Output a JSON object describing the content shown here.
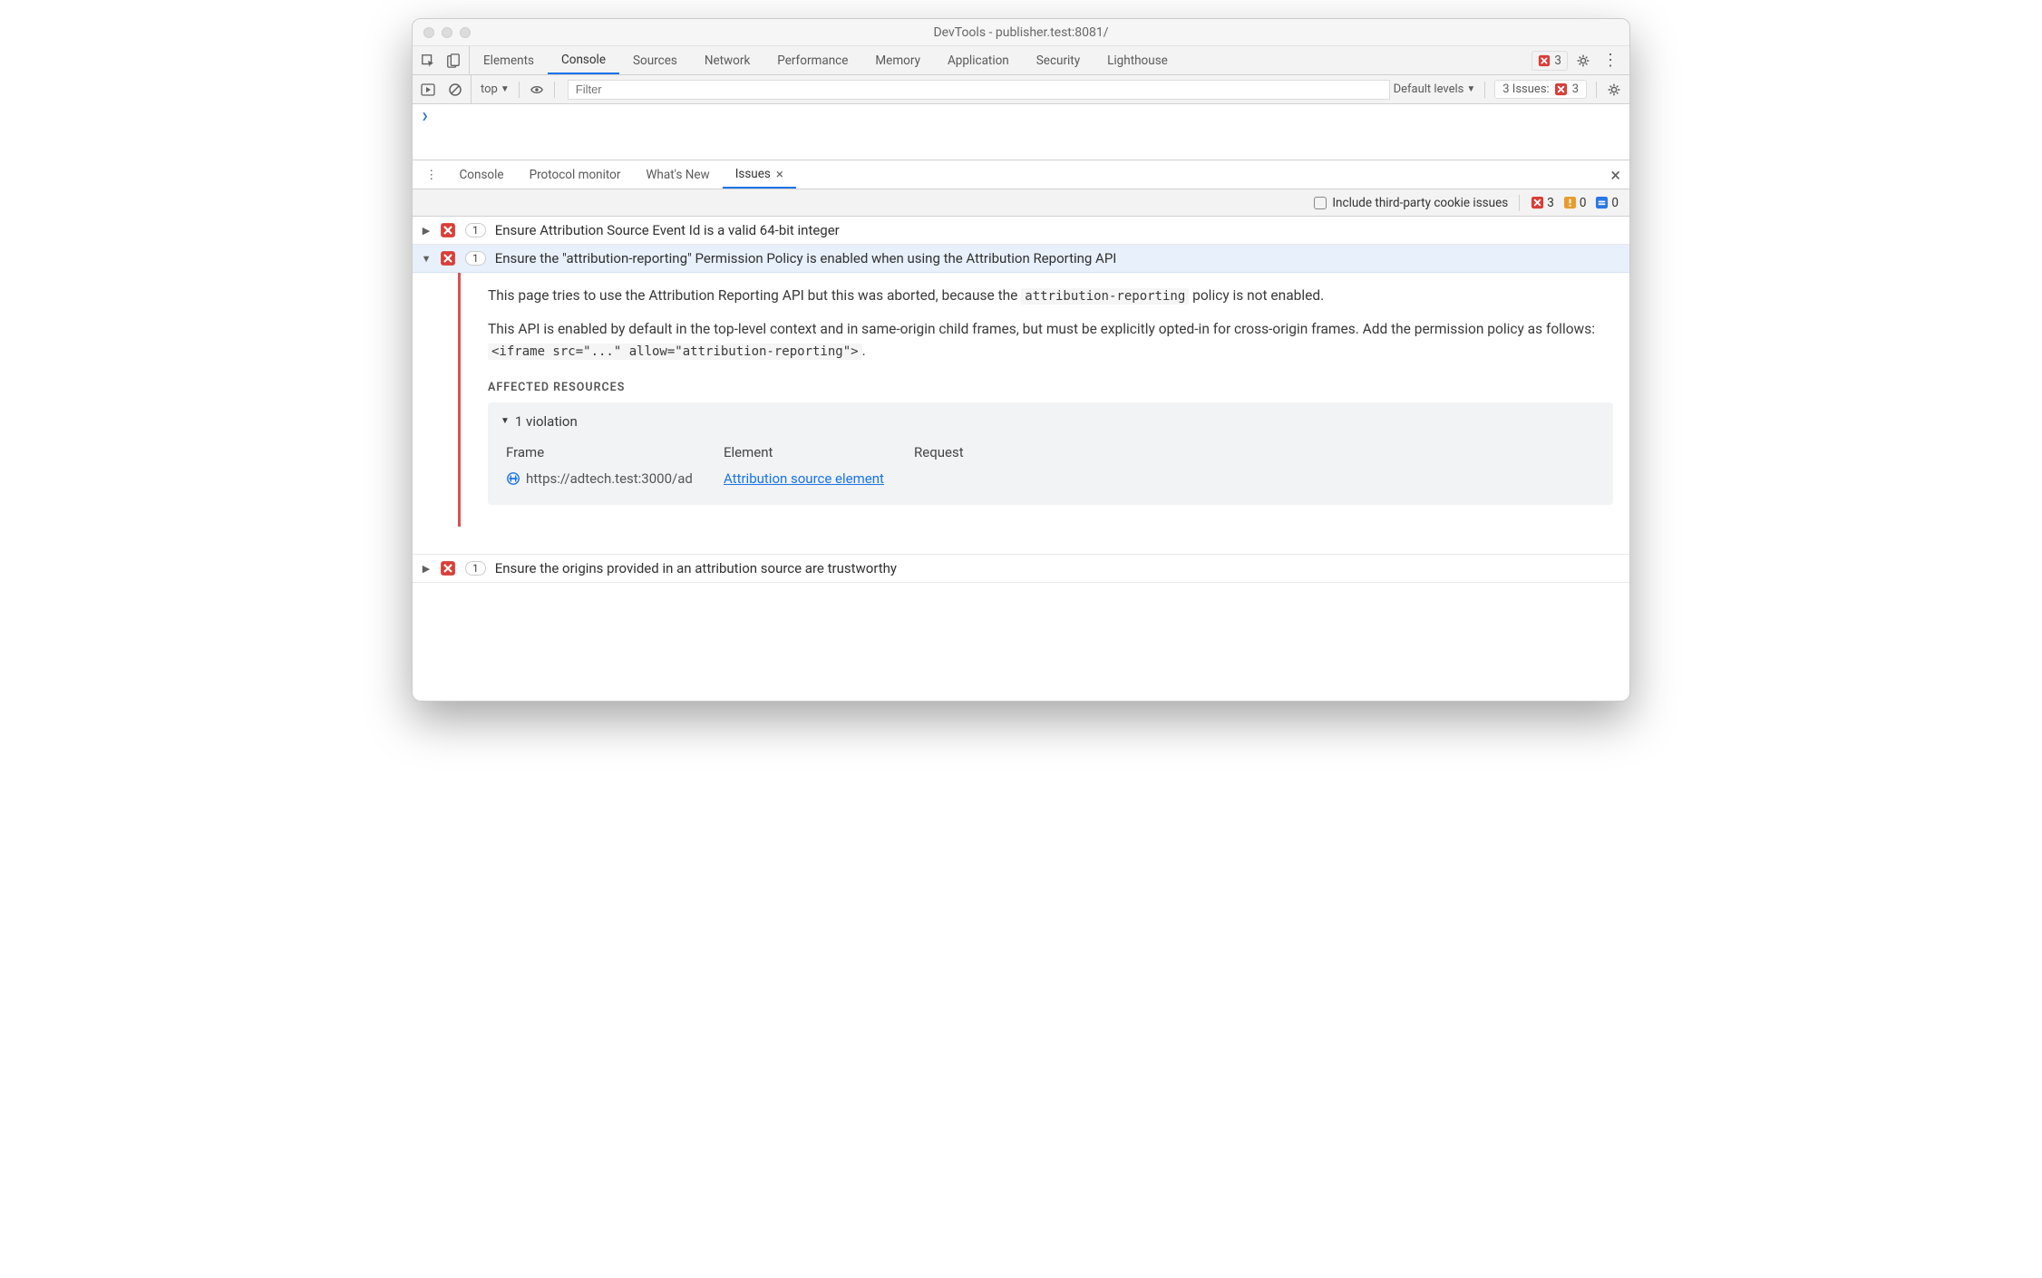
{
  "window": {
    "title": "DevTools - publisher.test:8081/"
  },
  "mainTabs": {
    "elements": "Elements",
    "console": "Console",
    "sources": "Sources",
    "network": "Network",
    "performance": "Performance",
    "memory": "Memory",
    "application": "Application",
    "security": "Security",
    "lighthouse": "Lighthouse"
  },
  "errorCount": "3",
  "consoleToolbar": {
    "context": "top",
    "filterPlaceholder": "Filter",
    "levels": "Default levels",
    "issuesLabel": "3 Issues:",
    "issuesCount": "3"
  },
  "consolePrompt": "❯",
  "drawerTabs": {
    "console": "Console",
    "protocol": "Protocol monitor",
    "whatsnew": "What's New",
    "issues": "Issues"
  },
  "issuesToolbar": {
    "includeThirdParty": "Include third-party cookie issues",
    "errCount": "3",
    "warnCount": "0",
    "infoCount": "0"
  },
  "issues": [
    {
      "count": "1",
      "title": "Ensure Attribution Source Event Id is a valid 64-bit integer"
    },
    {
      "count": "1",
      "title": "Ensure the \"attribution-reporting\" Permission Policy is enabled when using the Attribution Reporting API"
    },
    {
      "count": "1",
      "title": "Ensure the origins provided in an attribution source are trustworthy"
    }
  ],
  "detail": {
    "para1_a": "This page tries to use the Attribution Reporting API but this was aborted, because the ",
    "para1_code": "attribution-reporting",
    "para1_b": " policy is not enabled.",
    "para2_a": "This API is enabled by default in the top-level context and in same-origin child frames, but must be explicitly opted-in for cross-origin frames. Add the permission policy as follows: ",
    "para2_code": "<iframe src=\"...\" allow=\"attribution-reporting\">",
    "para2_b": ".",
    "affectedTitle": "AFFECTED RESOURCES",
    "violHeader": "1 violation",
    "col_frame": "Frame",
    "col_element": "Element",
    "col_request": "Request",
    "row_frame": "https://adtech.test:3000/ad",
    "row_element": "Attribution source element"
  }
}
